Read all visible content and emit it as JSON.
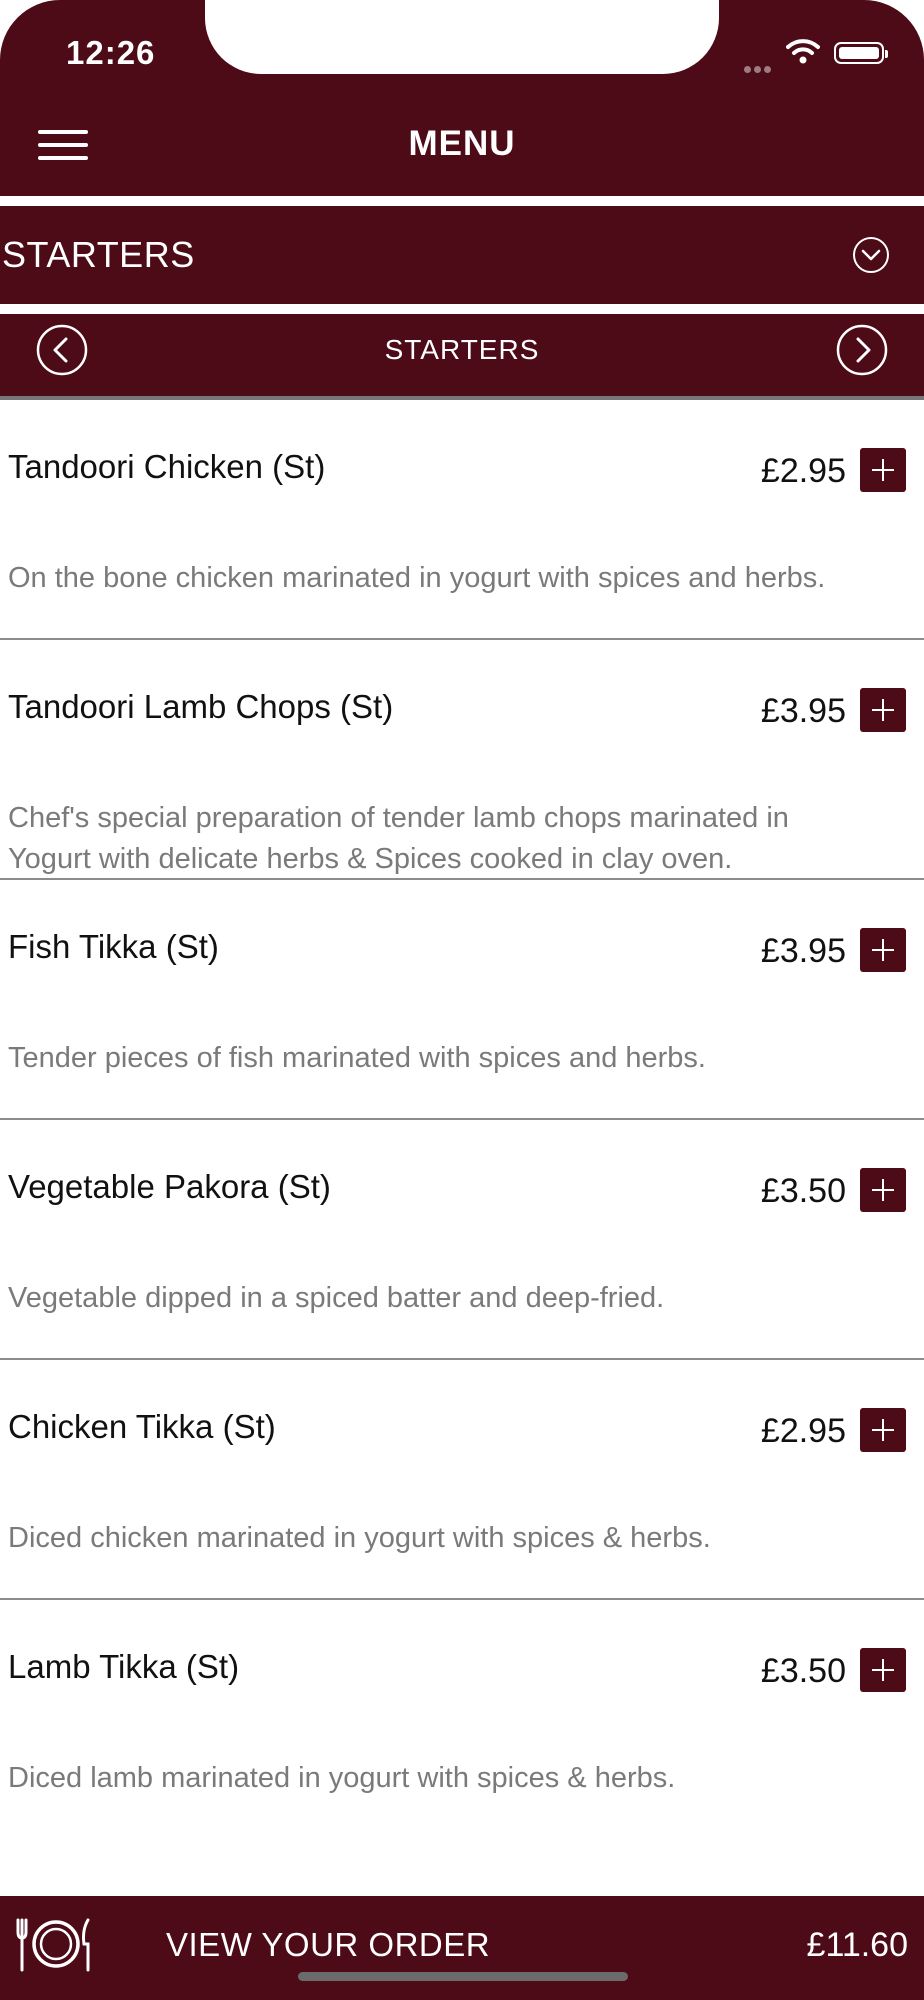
{
  "status": {
    "time": "12:26"
  },
  "header": {
    "title": "MENU"
  },
  "category_select": {
    "selected": "STARTERS"
  },
  "category_pager": {
    "title": "STARTERS"
  },
  "items": [
    {
      "name": "Tandoori Chicken (St)",
      "price": "£2.95",
      "description": "On the bone chicken marinated in yogurt with spices and herbs."
    },
    {
      "name": "Tandoori Lamb Chops (St)",
      "price": "£3.95",
      "description": "Chef's special preparation of tender lamb chops marinated in Yogurt with delicate herbs & Spices cooked in clay oven."
    },
    {
      "name": "Fish Tikka (St)",
      "price": "£3.95",
      "description": "Tender pieces of fish marinated with spices and herbs."
    },
    {
      "name": "Vegetable Pakora (St)",
      "price": "£3.50",
      "description": "Vegetable dipped in a spiced batter and deep-fried."
    },
    {
      "name": "Chicken Tikka (St)",
      "price": "£2.95",
      "description": "Diced chicken marinated in yogurt with spices & herbs."
    },
    {
      "name": "Lamb Tikka (St)",
      "price": "£3.50",
      "description": "Diced lamb marinated in yogurt with spices & herbs."
    }
  ],
  "order_bar": {
    "label": "VIEW YOUR ORDER",
    "total": "£11.60"
  },
  "colors": {
    "brand": "#4d0a17",
    "description_text": "#7a7a7a"
  }
}
